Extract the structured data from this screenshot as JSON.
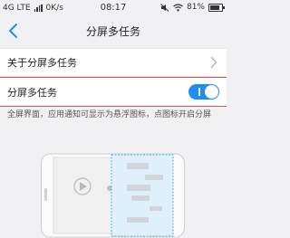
{
  "status_bar": {
    "network": "4G LTE",
    "speed": "0K/s",
    "time": "08:17",
    "battery": "81%",
    "battery_level": 0.81
  },
  "header": {
    "title": "分屏多任务"
  },
  "settings": {
    "about_label": "关于分屏多任务",
    "toggle_label": "分屏多任务",
    "toggle_on": true,
    "description": "全屏界面，应用通知可显示为悬浮图标，点图标开启分屏"
  },
  "colors": {
    "accent": "#1e8ff0",
    "highlight_border": "#d9534f",
    "background": "#f1f1f3"
  },
  "icons": [
    "back-arrow-icon",
    "chevron-right-icon",
    "toggle-switch",
    "phone-illustration"
  ]
}
